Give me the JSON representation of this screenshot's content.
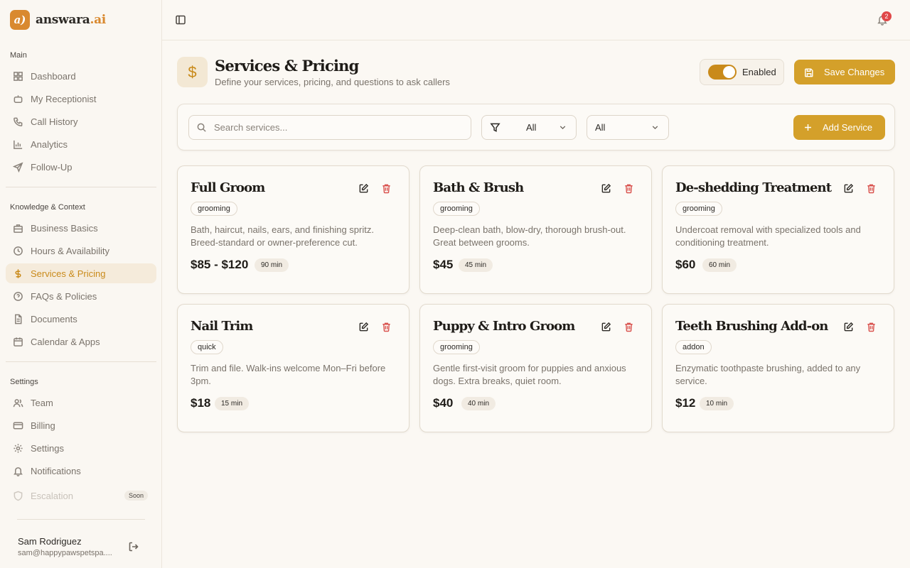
{
  "brand": {
    "mark": "a)",
    "name": "answara",
    "suffix": ".ai"
  },
  "sidebar": {
    "main_label": "Main",
    "main_items": [
      {
        "label": "Dashboard",
        "icon": "dashboard-icon"
      },
      {
        "label": "My Receptionist",
        "icon": "robot-icon"
      },
      {
        "label": "Call History",
        "icon": "phone-icon"
      },
      {
        "label": "Analytics",
        "icon": "bar-chart-icon"
      },
      {
        "label": "Follow-Up",
        "icon": "send-icon"
      }
    ],
    "knowledge_label": "Knowledge & Context",
    "knowledge_items": [
      {
        "label": "Business Basics",
        "icon": "briefcase-icon"
      },
      {
        "label": "Hours & Availability",
        "icon": "clock-icon"
      },
      {
        "label": "Services & Pricing",
        "icon": "dollar-icon",
        "active": true
      },
      {
        "label": "FAQs & Policies",
        "icon": "help-circle-icon"
      },
      {
        "label": "Documents",
        "icon": "document-icon"
      },
      {
        "label": "Calendar & Apps",
        "icon": "calendar-icon"
      }
    ],
    "settings_label": "Settings",
    "settings_items": [
      {
        "label": "Team",
        "icon": "users-icon"
      },
      {
        "label": "Billing",
        "icon": "credit-card-icon"
      },
      {
        "label": "Settings",
        "icon": "gear-icon"
      },
      {
        "label": "Notifications",
        "icon": "bell-icon"
      },
      {
        "label": "Escalation",
        "icon": "shield-icon",
        "badge": "Soon",
        "disabled": true
      }
    ],
    "user": {
      "name": "Sam Rodriguez",
      "email": "sam@happypawspetspa...."
    }
  },
  "topbar": {
    "notification_count": "2"
  },
  "header": {
    "icon": "$",
    "title": "Services & Pricing",
    "subtitle": "Define your services, pricing, and questions to ask callers",
    "toggle_label": "Enabled",
    "save_label": "Save Changes"
  },
  "filters": {
    "search_placeholder": "Search services...",
    "category_value": "All",
    "second_value": "All",
    "add_label": "Add Service"
  },
  "services": [
    {
      "title": "Full Groom",
      "tag": "grooming",
      "desc": "Bath, haircut, nails, ears, and finishing spritz. Breed-standard or owner-preference cut.",
      "price": "$85 - $120",
      "duration": "90 min"
    },
    {
      "title": "Bath & Brush",
      "tag": "grooming",
      "desc": "Deep-clean bath, blow-dry, thorough brush-out. Great between grooms.",
      "price": "$45",
      "duration": "45 min"
    },
    {
      "title": "De-shedding Treatment",
      "tag": "grooming",
      "desc": "Undercoat removal with specialized tools and conditioning treatment.",
      "price": "$60",
      "duration": "60 min"
    },
    {
      "title": "Nail Trim",
      "tag": "quick",
      "desc": "Trim and file. Walk-ins welcome Mon–Fri before 3pm.",
      "price": "$18",
      "duration": "15 min"
    },
    {
      "title": "Puppy & Intro Groom",
      "tag": "grooming",
      "desc": "Gentle first-visit groom for puppies and anxious dogs. Extra breaks, quiet room.",
      "price": "$40",
      "duration": "40 min"
    },
    {
      "title": "Teeth Brushing Add-on",
      "tag": "addon",
      "desc": "Enzymatic toothpaste brushing, added to any service.",
      "price": "$12",
      "duration": "10 min"
    }
  ],
  "colors": {
    "accent": "#d4a02a",
    "active_text": "#c98a1a",
    "delete": "#d9534f"
  }
}
